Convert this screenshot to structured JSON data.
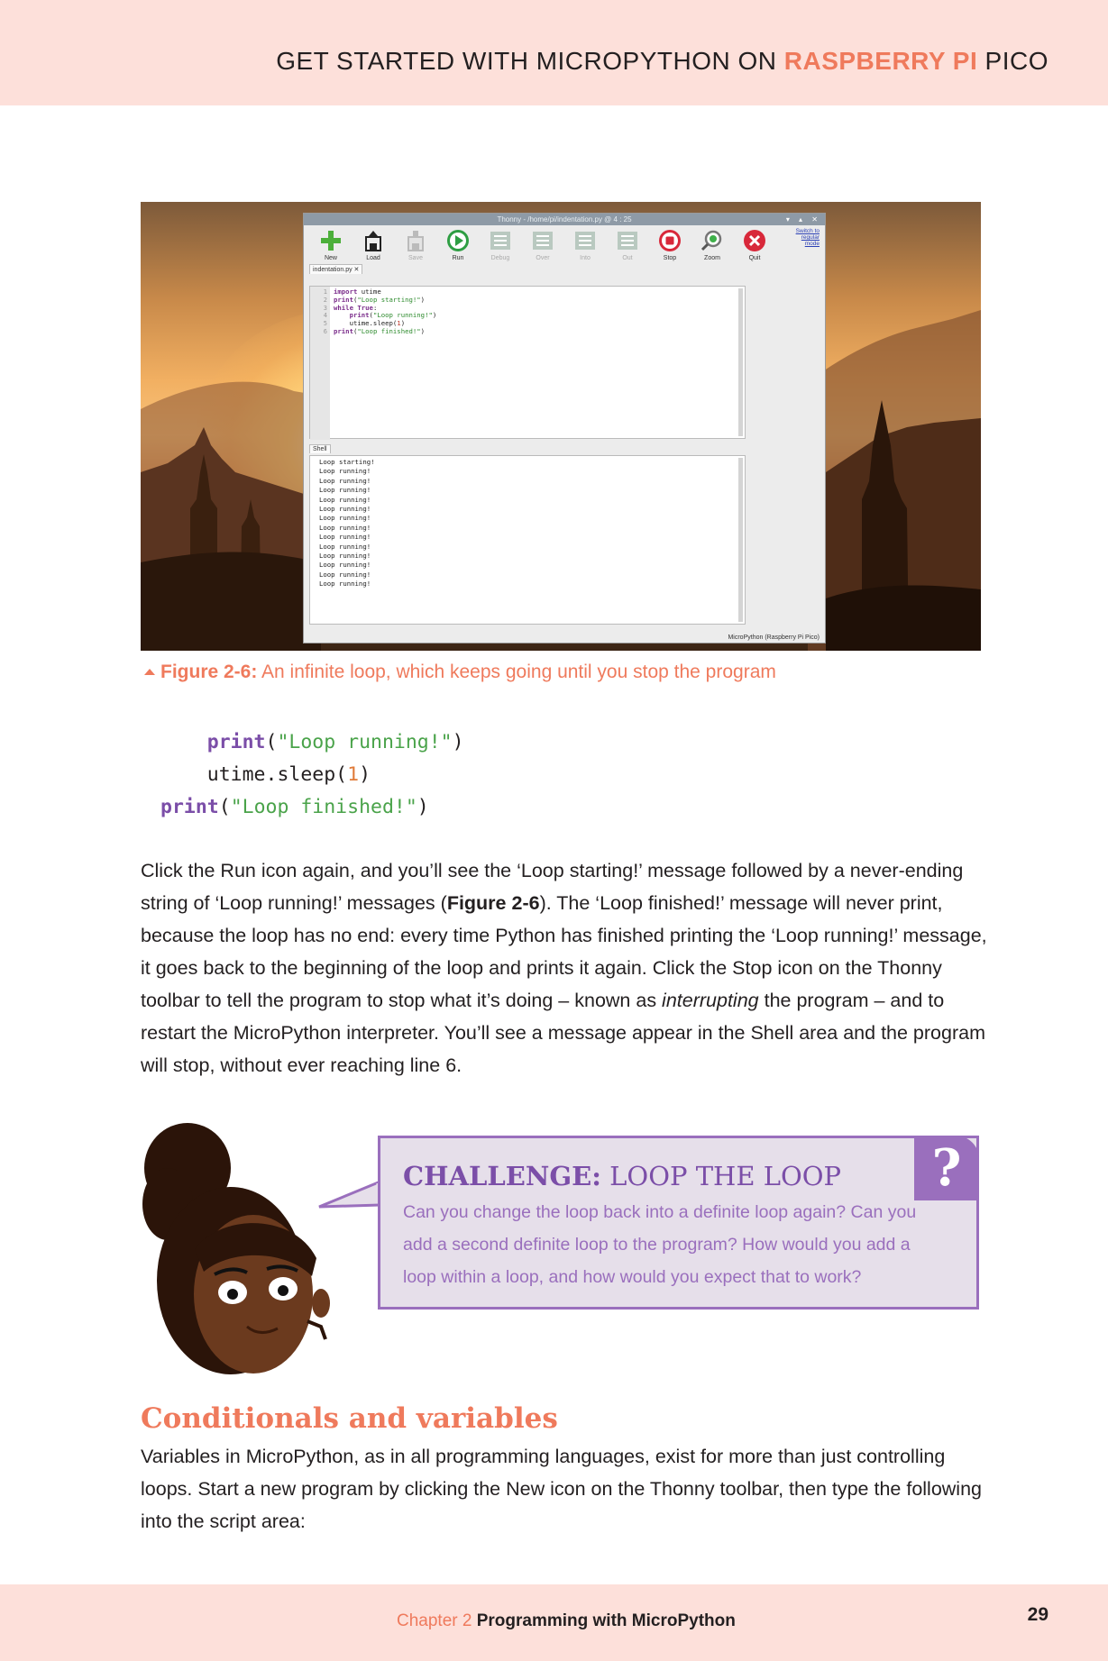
{
  "header": {
    "prefix": "GET STARTED WITH MICROPYTHON ON ",
    "accent": "RASPBERRY PI",
    "suffix": " PICO"
  },
  "thonny": {
    "title": "Thonny - /home/pi/indentation.py @ 4 : 25",
    "toolbar": [
      {
        "label": "New",
        "icon": "new-icon",
        "enabled": true
      },
      {
        "label": "Load",
        "icon": "load-icon",
        "enabled": true
      },
      {
        "label": "Save",
        "icon": "save-icon",
        "enabled": false
      },
      {
        "label": "Run",
        "icon": "run-icon",
        "enabled": true
      },
      {
        "label": "Debug",
        "icon": "debug-icon",
        "enabled": false
      },
      {
        "label": "Over",
        "icon": "step-over-icon",
        "enabled": false
      },
      {
        "label": "Into",
        "icon": "step-into-icon",
        "enabled": false
      },
      {
        "label": "Out",
        "icon": "step-out-icon",
        "enabled": false
      },
      {
        "label": "Stop",
        "icon": "stop-icon",
        "enabled": true
      },
      {
        "label": "Zoom",
        "icon": "zoom-icon",
        "enabled": true
      },
      {
        "label": "Quit",
        "icon": "quit-icon",
        "enabled": true
      }
    ],
    "switch_mode": "Switch to regular mode",
    "editor_tab": "indentation.py ✕",
    "line_numbers": [
      "1",
      "2",
      "3",
      "4",
      "5",
      "6"
    ],
    "code_lines": [
      "import utime",
      "print(\"Loop starting!\")",
      "while True:",
      "    print(\"Loop running!\")",
      "    utime.sleep(1)",
      "print(\"Loop finished!\")"
    ],
    "shell_tab": "Shell",
    "shell_lines": [
      "Loop starting!",
      "Loop running!",
      "Loop running!",
      "Loop running!",
      "Loop running!",
      "Loop running!",
      "Loop running!",
      "Loop running!",
      "Loop running!",
      "Loop running!",
      "Loop running!",
      "Loop running!",
      "Loop running!",
      "Loop running!"
    ],
    "status": "MicroPython (Raspberry Pi Pico)"
  },
  "caption": {
    "label": "Figure 2-6:",
    "text": " An infinite loop, which keeps going until you stop the program"
  },
  "listing": {
    "line1_fn": "print",
    "line1_str": "\"Loop running!\"",
    "line2_obj": "utime.sleep(",
    "line2_num": "1",
    "line2_end": ")",
    "line3_fn": "print",
    "line3_str": "\"Loop finished!\""
  },
  "paragraph1": {
    "a": "Click the Run icon again, and  you’ll see the ‘Loop starting!’ message followed by a never-ending string of ‘Loop running!’ messages (",
    "b": "Figure 2-6",
    "c": "). The ‘Loop finished!’ message will never print, because the loop has no end: every time Python has finished printing the ‘Loop running!’ message, it goes back to the beginning of the loop and prints it again. Click the Stop icon on the Thonny toolbar to tell the program to stop what it’s doing – known as ",
    "d": "interrupting",
    "e": " the program – and to restart the MicroPython interpreter. You’ll see a message appear in the Shell area and the program will stop, without ever reaching line 6."
  },
  "challenge": {
    "title_bold": "CHALLENGE:",
    "title_rest": " LOOP THE LOOP",
    "body": "Can you change the loop back into a definite loop again? Can you add a second definite loop to the program? How would you add a loop within a loop, and how would you expect that to work?",
    "badge": "?"
  },
  "section": {
    "heading": "Conditionals and variables",
    "body": "Variables in MicroPython, as in all programming languages, exist for more than just controlling loops. Start a new program by clicking the New icon on the Thonny toolbar, then type the following into the script area:"
  },
  "footer": {
    "chapter": "Chapter 2 ",
    "title": "Programming with MicroPython",
    "page": "29"
  },
  "colors": {
    "accent": "#ef7a5c",
    "band": "#fde0da",
    "challenge": "#9a6fbd",
    "challenge_bg": "#e6dfea"
  }
}
